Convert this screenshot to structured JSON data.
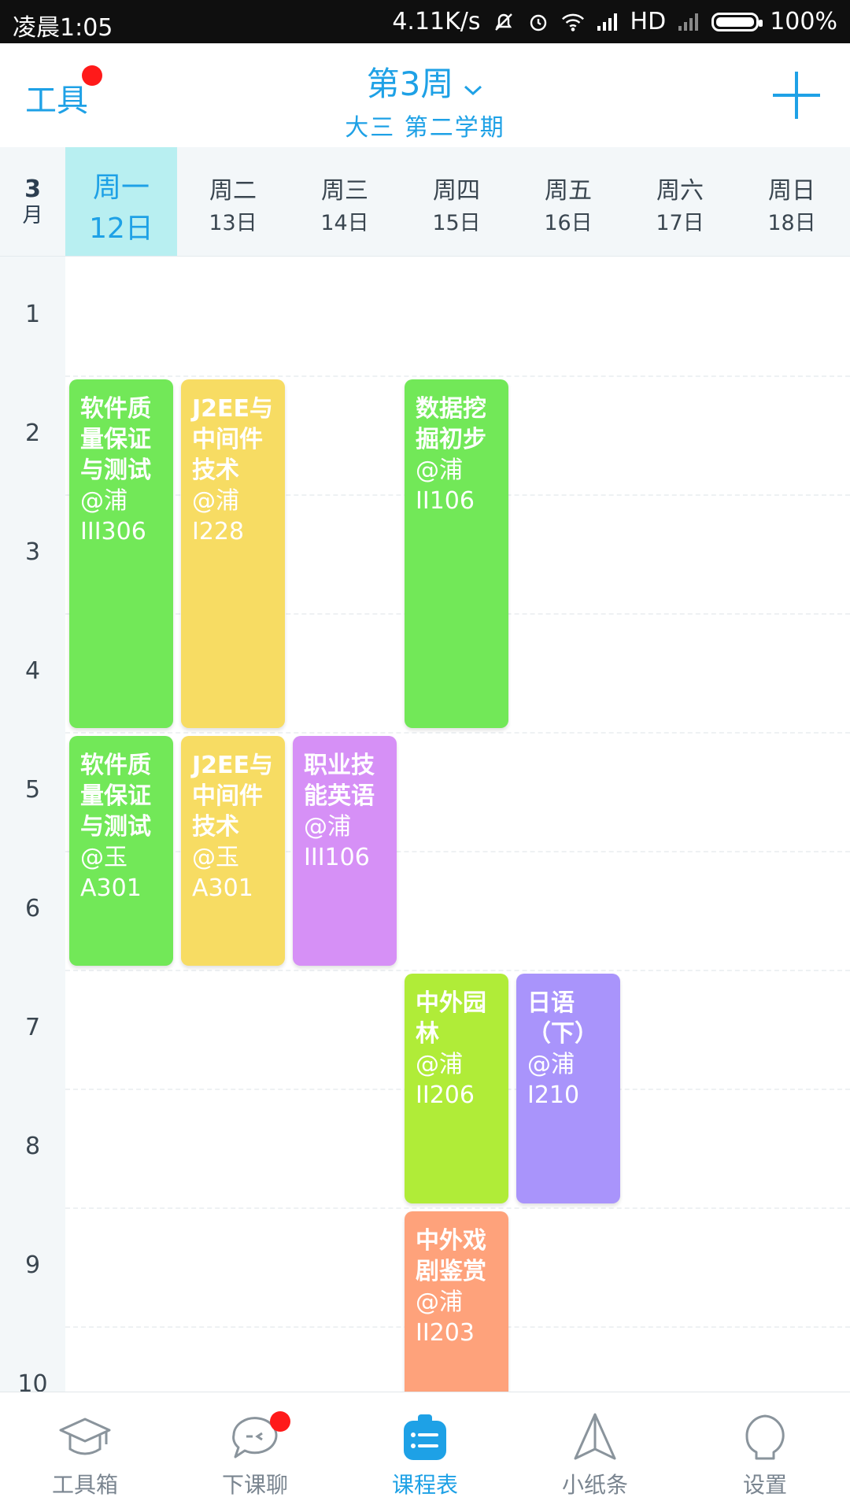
{
  "status_bar": {
    "time": "凌晨1:05",
    "net_speed": "4.11K/s",
    "network": "HD",
    "battery": "100%"
  },
  "header": {
    "tools_label": "工具",
    "week_title": "第3周",
    "semester": "大三  第二学期",
    "accent_color": "#1ea1e6"
  },
  "day_header": {
    "month_num": "3",
    "month_unit": "月",
    "days": [
      {
        "weekday": "周一",
        "date": "12日"
      },
      {
        "weekday": "周二",
        "date": "13日"
      },
      {
        "weekday": "周三",
        "date": "14日"
      },
      {
        "weekday": "周四",
        "date": "15日"
      },
      {
        "weekday": "周五",
        "date": "16日"
      },
      {
        "weekday": "周六",
        "date": "17日"
      },
      {
        "weekday": "周日",
        "date": "18日"
      }
    ]
  },
  "periods": [
    "1",
    "2",
    "3",
    "4",
    "5",
    "6",
    "7",
    "8",
    "9",
    "10"
  ],
  "courses": [
    {
      "name": "软件质量保证与测试",
      "room": "@浦III306",
      "day": 1,
      "start": 2,
      "end": 4,
      "color": "#72e858"
    },
    {
      "name": "J2EE与中间件技术",
      "room": "@浦I228",
      "day": 2,
      "start": 2,
      "end": 4,
      "color": "#f7dc63"
    },
    {
      "name": "数据挖掘初步",
      "room": "@浦II106",
      "day": 4,
      "start": 2,
      "end": 4,
      "color": "#72e858"
    },
    {
      "name": "软件质量保证与测试",
      "room": "@玉A301",
      "day": 1,
      "start": 5,
      "end": 6,
      "color": "#72e858"
    },
    {
      "name": "J2EE与中间件技术",
      "room": "@玉A301",
      "day": 2,
      "start": 5,
      "end": 6,
      "color": "#f7dc63"
    },
    {
      "name": "职业技能英语",
      "room": "@浦III106",
      "day": 3,
      "start": 5,
      "end": 6,
      "color": "#d690f6"
    },
    {
      "name": "中外园林",
      "room": "@浦II206",
      "day": 4,
      "start": 7,
      "end": 8,
      "color": "#b0ec38"
    },
    {
      "name": "日语（下）",
      "room": "@浦I210",
      "day": 5,
      "start": 7,
      "end": 8,
      "color": "#a994fb"
    },
    {
      "name": "中外戏剧鉴赏",
      "room": "@浦II203",
      "day": 4,
      "start": 9,
      "end": 10,
      "color": "#fea27b"
    }
  ],
  "bottom_nav": [
    {
      "label": "工具箱",
      "icon": "graduation-cap-icon",
      "active": false
    },
    {
      "label": "下课聊",
      "icon": "chat-bubble-icon",
      "active": false
    },
    {
      "label": "课程表",
      "icon": "schedule-clipboard-icon",
      "active": true
    },
    {
      "label": "小纸条",
      "icon": "paper-plane-icon",
      "active": false
    },
    {
      "label": "设置",
      "icon": "settings-head-icon",
      "active": false
    }
  ]
}
